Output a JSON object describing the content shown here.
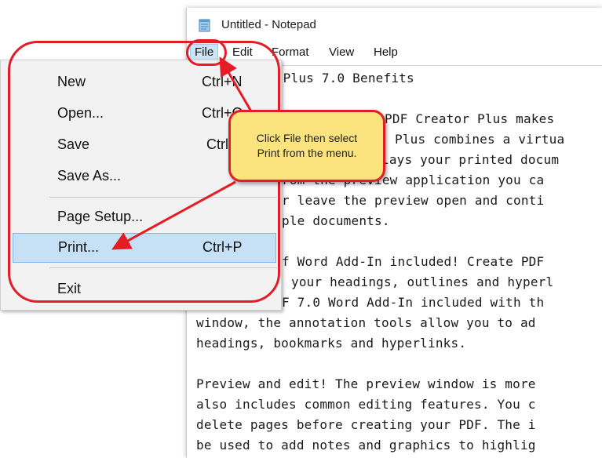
{
  "window": {
    "title": "Untitled - Notepad",
    "icon": "notepad-icon"
  },
  "menubar": {
    "items": [
      "File",
      "Edit",
      "Format",
      "View",
      "Help"
    ]
  },
  "editor": {
    "lines": [
      "r Plus 7.0 Benefits",
      "PDF Creator Plus makes",
      "Plus combines a virtua",
      "lays your printed docum",
      "rom the preview application you ca",
      "r leave the preview open and conti",
      "ple documents.",
      "",
      "f Word Add-In included! Create PDF",
      "your headings, outlines and hyperl",
      "F 7.0 Word Add-In included with th",
      "window, the annotation tools allow you to ad",
      "headings, bookmarks and hyperlinks.",
      "",
      "Preview and edit! The preview window is more",
      "also includes common editing features. You c",
      "delete pages before creating your PDF. The i",
      "be used to add notes and graphics to highlig"
    ]
  },
  "file_menu": {
    "items": [
      {
        "label": "New",
        "shortcut": "Ctrl+N"
      },
      {
        "label": "Open...",
        "shortcut": "Ctrl+O"
      },
      {
        "label": "Save",
        "shortcut": "Ctrl+S"
      },
      {
        "label": "Save As...",
        "shortcut": ""
      },
      {
        "label": "Page Setup...",
        "shortcut": ""
      },
      {
        "label": "Print...",
        "shortcut": "Ctrl+P"
      },
      {
        "label": "Exit",
        "shortcut": ""
      }
    ]
  },
  "callout": {
    "text": "Click File then select\nPrint from the menu."
  },
  "colors": {
    "annotation_red": "#e31d25",
    "callout_fill": "#fbe37d",
    "menu_highlight": "#c6e0f5"
  }
}
